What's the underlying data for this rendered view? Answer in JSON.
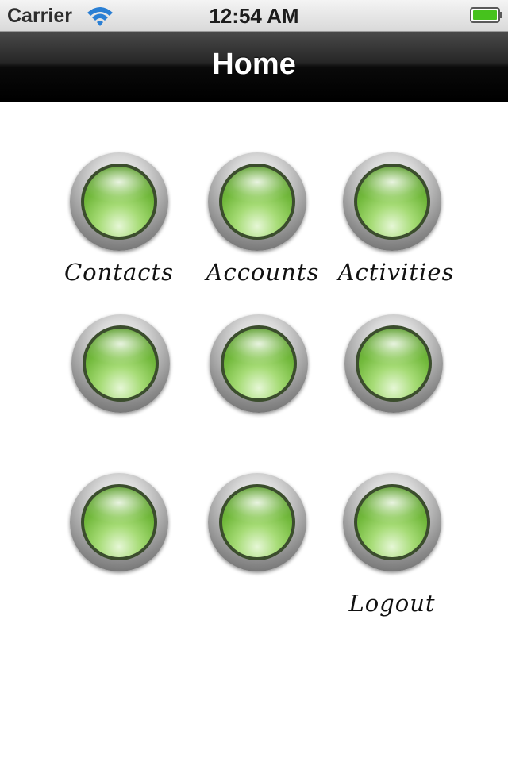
{
  "status_bar": {
    "carrier": "Carrier",
    "time": "12:54 AM",
    "wifi_icon": "wifi-icon",
    "battery_icon": "battery-full-icon",
    "battery_color": "#46c21d"
  },
  "nav_bar": {
    "title": "Home"
  },
  "grid": {
    "button_color": "#72b93c",
    "items": [
      {
        "label": "Contacts"
      },
      {
        "label": "Accounts"
      },
      {
        "label": "Activities"
      },
      {
        "label": ""
      },
      {
        "label": ""
      },
      {
        "label": ""
      },
      {
        "label": ""
      },
      {
        "label": ""
      },
      {
        "label": "Logout"
      }
    ]
  }
}
